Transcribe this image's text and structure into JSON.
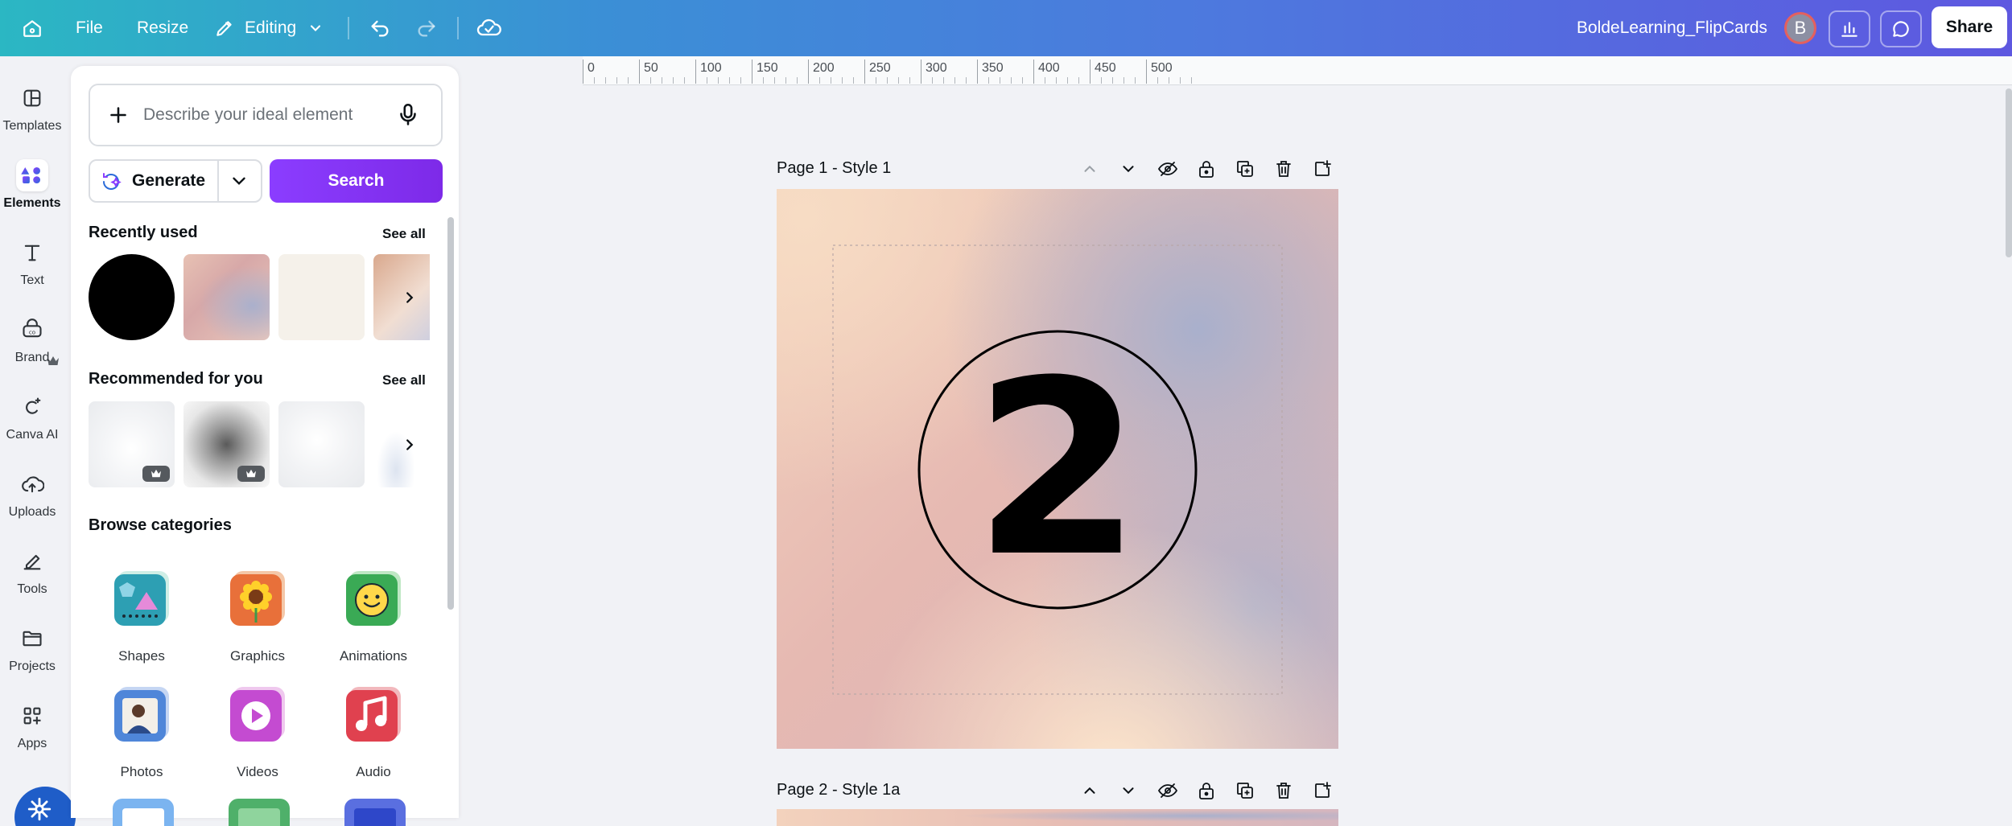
{
  "topbar": {
    "file_label": "File",
    "resize_label": "Resize",
    "editing_label": "Editing",
    "doc_title": "BoldeLearning_FlipCards",
    "avatar_initial": "B",
    "share_label": "Share"
  },
  "rail": {
    "items": [
      {
        "label": "Templates",
        "icon": "templates-icon"
      },
      {
        "label": "Elements",
        "icon": "elements-icon"
      },
      {
        "label": "Text",
        "icon": "text-icon"
      },
      {
        "label": "Brand",
        "icon": "brand-icon"
      },
      {
        "label": "Canva AI",
        "icon": "canva-ai-icon"
      },
      {
        "label": "Uploads",
        "icon": "uploads-icon"
      },
      {
        "label": "Tools",
        "icon": "tools-icon"
      },
      {
        "label": "Projects",
        "icon": "projects-icon"
      },
      {
        "label": "Apps",
        "icon": "apps-icon"
      }
    ]
  },
  "panel": {
    "ai_placeholder": "Describe your ideal element",
    "generate_label": "Generate",
    "search_label": "Search",
    "recently_used_title": "Recently used",
    "recommended_title": "Recommended for you",
    "see_all_label": "See all",
    "browse_title": "Browse categories",
    "categories": [
      {
        "label": "Shapes"
      },
      {
        "label": "Graphics"
      },
      {
        "label": "Animations"
      },
      {
        "label": "Photos"
      },
      {
        "label": "Videos"
      },
      {
        "label": "Audio"
      }
    ]
  },
  "ruler": {
    "marks": [
      "0",
      "50",
      "100",
      "150",
      "200",
      "250",
      "300",
      "350",
      "400",
      "450",
      "500"
    ]
  },
  "canvas": {
    "page1_label": "Page 1 - Style 1",
    "page2_label": "Page 2 - Style 1a",
    "big_number": "2"
  },
  "colors": {
    "accent": "#8b3dff",
    "topbar_start": "#2bb7c3",
    "topbar_end": "#5e58e0"
  }
}
